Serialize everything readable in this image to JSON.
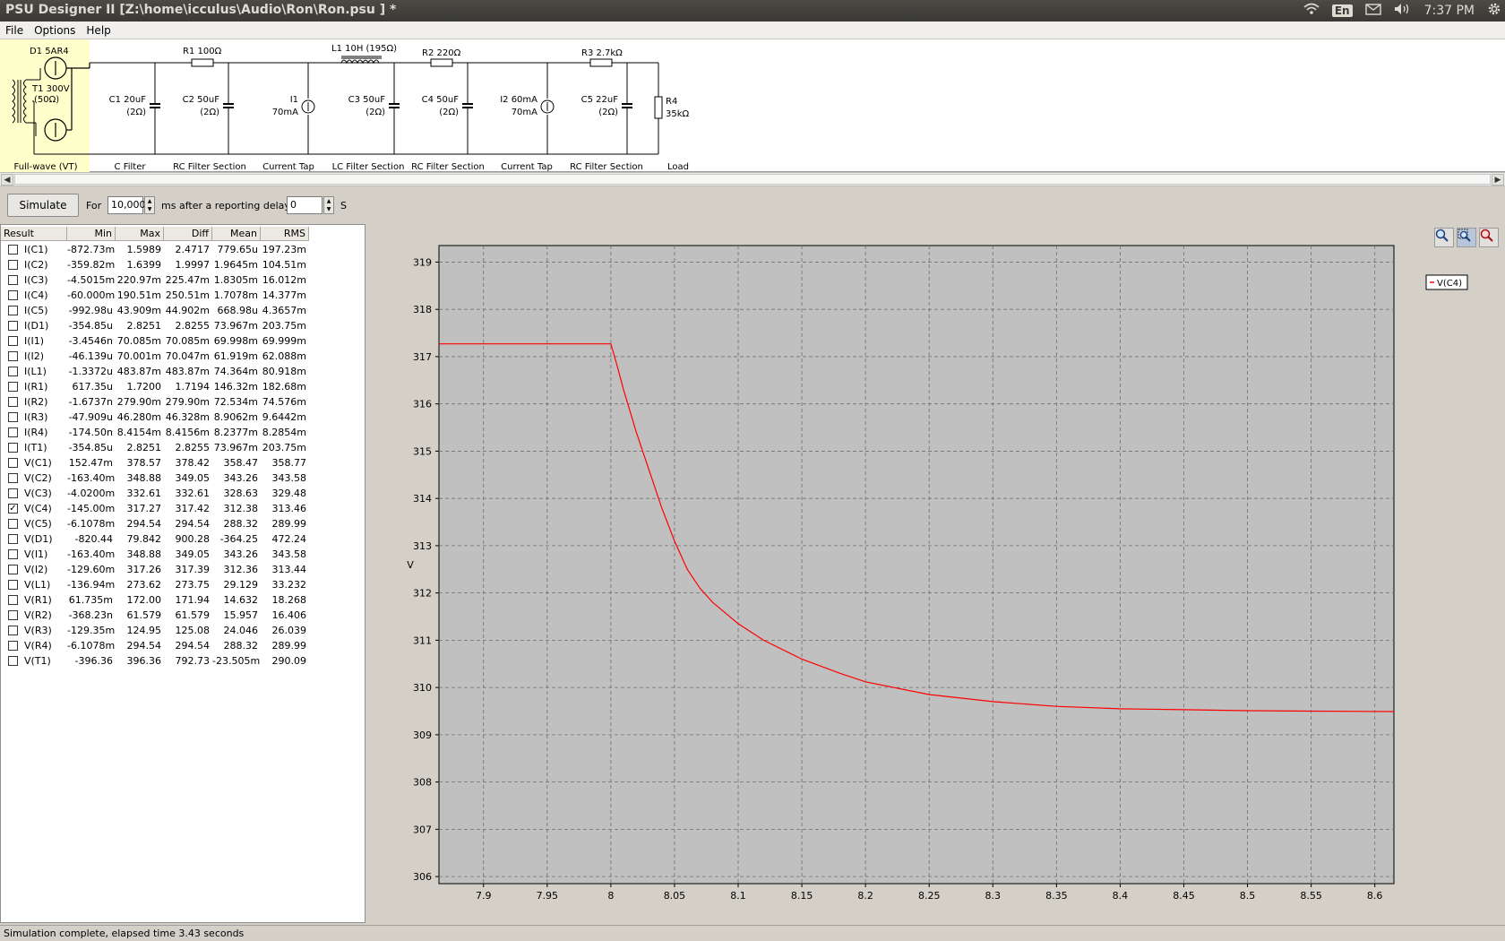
{
  "window": {
    "title": "PSU Designer II  [Z:\\home\\icculus\\Audio\\Ron\\Ron.psu ] *",
    "lang": "En",
    "clock": "7:37 PM"
  },
  "menu": [
    "File",
    "Options",
    "Help"
  ],
  "schematic": {
    "components": [
      {
        "id": "D1",
        "text": "D1 5AR4"
      },
      {
        "id": "T1",
        "text": "T1 300V"
      },
      {
        "id": "T1r",
        "text": "(50Ω)"
      },
      {
        "id": "C1",
        "text": "C1 20uF"
      },
      {
        "id": "C1r",
        "text": "(2Ω)"
      },
      {
        "id": "R1",
        "text": "R1 100Ω"
      },
      {
        "id": "C2",
        "text": "C2 50uF"
      },
      {
        "id": "C2r",
        "text": "(2Ω)"
      },
      {
        "id": "I1",
        "text": "I1"
      },
      {
        "id": "I1v",
        "text": "70mA"
      },
      {
        "id": "L1",
        "text": "L1 10H (195Ω)"
      },
      {
        "id": "C3",
        "text": "C3 50uF"
      },
      {
        "id": "C3r",
        "text": "(2Ω)"
      },
      {
        "id": "R2",
        "text": "R2 220Ω"
      },
      {
        "id": "C4",
        "text": "C4 50uF"
      },
      {
        "id": "C4r",
        "text": "(2Ω)"
      },
      {
        "id": "I2",
        "text": "I2 60mA"
      },
      {
        "id": "I2v",
        "text": "70mA"
      },
      {
        "id": "R3",
        "text": "R3 2.7kΩ"
      },
      {
        "id": "C5",
        "text": "C5 22uF"
      },
      {
        "id": "C5r",
        "text": "(2Ω)"
      },
      {
        "id": "R4",
        "text": "R4"
      },
      {
        "id": "R4v",
        "text": "35kΩ"
      }
    ],
    "sections": [
      "Full-wave (VT)",
      "C Filter",
      "RC Filter Section",
      "Current Tap",
      "LC Filter Section",
      "RC Filter Section",
      "Current Tap",
      "RC Filter Section",
      "Load"
    ]
  },
  "sim": {
    "button": "Simulate",
    "for_label": "For",
    "duration": "10,000",
    "unit": "ms",
    "delay_label": "after a reporting delay of",
    "delay": "0",
    "delay_unit": "S"
  },
  "results": {
    "headers": [
      "Result",
      "Min",
      "Max",
      "Diff",
      "Mean",
      "RMS"
    ],
    "rows": [
      {
        "name": "I(C1)",
        "checked": false,
        "min": "-872.73m",
        "max": "1.5989",
        "diff": "2.4717",
        "mean": "779.65u",
        "rms": "197.23m"
      },
      {
        "name": "I(C2)",
        "checked": false,
        "min": "-359.82m",
        "max": "1.6399",
        "diff": "1.9997",
        "mean": "1.9645m",
        "rms": "104.51m"
      },
      {
        "name": "I(C3)",
        "checked": false,
        "min": "-4.5015m",
        "max": "220.97m",
        "diff": "225.47m",
        "mean": "1.8305m",
        "rms": "16.012m"
      },
      {
        "name": "I(C4)",
        "checked": false,
        "min": "-60.000m",
        "max": "190.51m",
        "diff": "250.51m",
        "mean": "1.7078m",
        "rms": "14.377m"
      },
      {
        "name": "I(C5)",
        "checked": false,
        "min": "-992.98u",
        "max": "43.909m",
        "diff": "44.902m",
        "mean": "668.98u",
        "rms": "4.3657m"
      },
      {
        "name": "I(D1)",
        "checked": false,
        "min": "-354.85u",
        "max": "2.8251",
        "diff": "2.8255",
        "mean": "73.967m",
        "rms": "203.75m"
      },
      {
        "name": "I(I1)",
        "checked": false,
        "min": "-3.4546n",
        "max": "70.085m",
        "diff": "70.085m",
        "mean": "69.998m",
        "rms": "69.999m"
      },
      {
        "name": "I(I2)",
        "checked": false,
        "min": "-46.139u",
        "max": "70.001m",
        "diff": "70.047m",
        "mean": "61.919m",
        "rms": "62.088m"
      },
      {
        "name": "I(L1)",
        "checked": false,
        "min": "-1.3372u",
        "max": "483.87m",
        "diff": "483.87m",
        "mean": "74.364m",
        "rms": "80.918m"
      },
      {
        "name": "I(R1)",
        "checked": false,
        "min": "617.35u",
        "max": "1.7200",
        "diff": "1.7194",
        "mean": "146.32m",
        "rms": "182.68m"
      },
      {
        "name": "I(R2)",
        "checked": false,
        "min": "-1.6737n",
        "max": "279.90m",
        "diff": "279.90m",
        "mean": "72.534m",
        "rms": "74.576m"
      },
      {
        "name": "I(R3)",
        "checked": false,
        "min": "-47.909u",
        "max": "46.280m",
        "diff": "46.328m",
        "mean": "8.9062m",
        "rms": "9.6442m"
      },
      {
        "name": "I(R4)",
        "checked": false,
        "min": "-174.50n",
        "max": "8.4154m",
        "diff": "8.4156m",
        "mean": "8.2377m",
        "rms": "8.2854m"
      },
      {
        "name": "I(T1)",
        "checked": false,
        "min": "-354.85u",
        "max": "2.8251",
        "diff": "2.8255",
        "mean": "73.967m",
        "rms": "203.75m"
      },
      {
        "name": "V(C1)",
        "checked": false,
        "min": "152.47m",
        "max": "378.57",
        "diff": "378.42",
        "mean": "358.47",
        "rms": "358.77"
      },
      {
        "name": "V(C2)",
        "checked": false,
        "min": "-163.40m",
        "max": "348.88",
        "diff": "349.05",
        "mean": "343.26",
        "rms": "343.58"
      },
      {
        "name": "V(C3)",
        "checked": false,
        "min": "-4.0200m",
        "max": "332.61",
        "diff": "332.61",
        "mean": "328.63",
        "rms": "329.48"
      },
      {
        "name": "V(C4)",
        "checked": true,
        "min": "-145.00m",
        "max": "317.27",
        "diff": "317.42",
        "mean": "312.38",
        "rms": "313.46"
      },
      {
        "name": "V(C5)",
        "checked": false,
        "min": "-6.1078m",
        "max": "294.54",
        "diff": "294.54",
        "mean": "288.32",
        "rms": "289.99"
      },
      {
        "name": "V(D1)",
        "checked": false,
        "min": "-820.44",
        "max": "79.842",
        "diff": "900.28",
        "mean": "-364.25",
        "rms": "472.24"
      },
      {
        "name": "V(I1)",
        "checked": false,
        "min": "-163.40m",
        "max": "348.88",
        "diff": "349.05",
        "mean": "343.26",
        "rms": "343.58"
      },
      {
        "name": "V(I2)",
        "checked": false,
        "min": "-129.60m",
        "max": "317.26",
        "diff": "317.39",
        "mean": "312.36",
        "rms": "313.44"
      },
      {
        "name": "V(L1)",
        "checked": false,
        "min": "-136.94m",
        "max": "273.62",
        "diff": "273.75",
        "mean": "29.129",
        "rms": "33.232"
      },
      {
        "name": "V(R1)",
        "checked": false,
        "min": "61.735m",
        "max": "172.00",
        "diff": "171.94",
        "mean": "14.632",
        "rms": "18.268"
      },
      {
        "name": "V(R2)",
        "checked": false,
        "min": "-368.23n",
        "max": "61.579",
        "diff": "61.579",
        "mean": "15.957",
        "rms": "16.406"
      },
      {
        "name": "V(R3)",
        "checked": false,
        "min": "-129.35m",
        "max": "124.95",
        "diff": "125.08",
        "mean": "24.046",
        "rms": "26.039"
      },
      {
        "name": "V(R4)",
        "checked": false,
        "min": "-6.1078m",
        "max": "294.54",
        "diff": "294.54",
        "mean": "288.32",
        "rms": "289.99"
      },
      {
        "name": "V(T1)",
        "checked": false,
        "min": "-396.36",
        "max": "396.36",
        "diff": "792.73",
        "mean": "-23.505m",
        "rms": "290.09"
      }
    ]
  },
  "zoom_icons": [
    "zoom-in-icon",
    "zoom-box-icon",
    "zoom-out-icon"
  ],
  "chart_data": {
    "type": "line",
    "ylabel": "V",
    "xlim": [
      7.865,
      8.615
    ],
    "ylim": [
      305.85,
      319.35
    ],
    "xticks": [
      7.9,
      7.95,
      8,
      8.05,
      8.1,
      8.15,
      8.2,
      8.25,
      8.3,
      8.35,
      8.4,
      8.45,
      8.5,
      8.55,
      8.6
    ],
    "xtick_labels": [
      "7.9",
      "7.95",
      "8",
      "8.05",
      "8.1",
      "8.15",
      "8.2",
      "8.25",
      "8.3",
      "8.35",
      "8.4",
      "8.45",
      "8.5",
      "8.55",
      "8.6"
    ],
    "yticks": [
      306,
      307,
      308,
      309,
      310,
      311,
      312,
      313,
      314,
      315,
      316,
      317,
      318,
      319
    ],
    "ytick_labels": [
      "306",
      "307",
      "308",
      "309",
      "310",
      "311",
      "312",
      "313",
      "314",
      "315",
      "316",
      "317",
      "318",
      "319"
    ],
    "grid": true,
    "legend_position": "right",
    "background": "#c0c0c0",
    "series": [
      {
        "name": "V(C4)",
        "color": "#ff0000",
        "x": [
          7.865,
          7.9,
          7.95,
          8.0,
          8.005,
          8.01,
          8.02,
          8.03,
          8.04,
          8.05,
          8.06,
          8.07,
          8.08,
          8.1,
          8.12,
          8.15,
          8.18,
          8.2,
          8.25,
          8.3,
          8.35,
          8.4,
          8.45,
          8.5,
          8.55,
          8.615
        ],
        "y": [
          317.27,
          317.27,
          317.27,
          317.27,
          316.8,
          316.3,
          315.4,
          314.6,
          313.8,
          313.1,
          312.5,
          312.1,
          311.8,
          311.35,
          311.0,
          310.6,
          310.3,
          310.12,
          309.85,
          309.7,
          309.6,
          309.55,
          309.53,
          309.51,
          309.5,
          309.49
        ]
      }
    ]
  },
  "status": "Simulation complete, elapsed time 3.43 seconds"
}
